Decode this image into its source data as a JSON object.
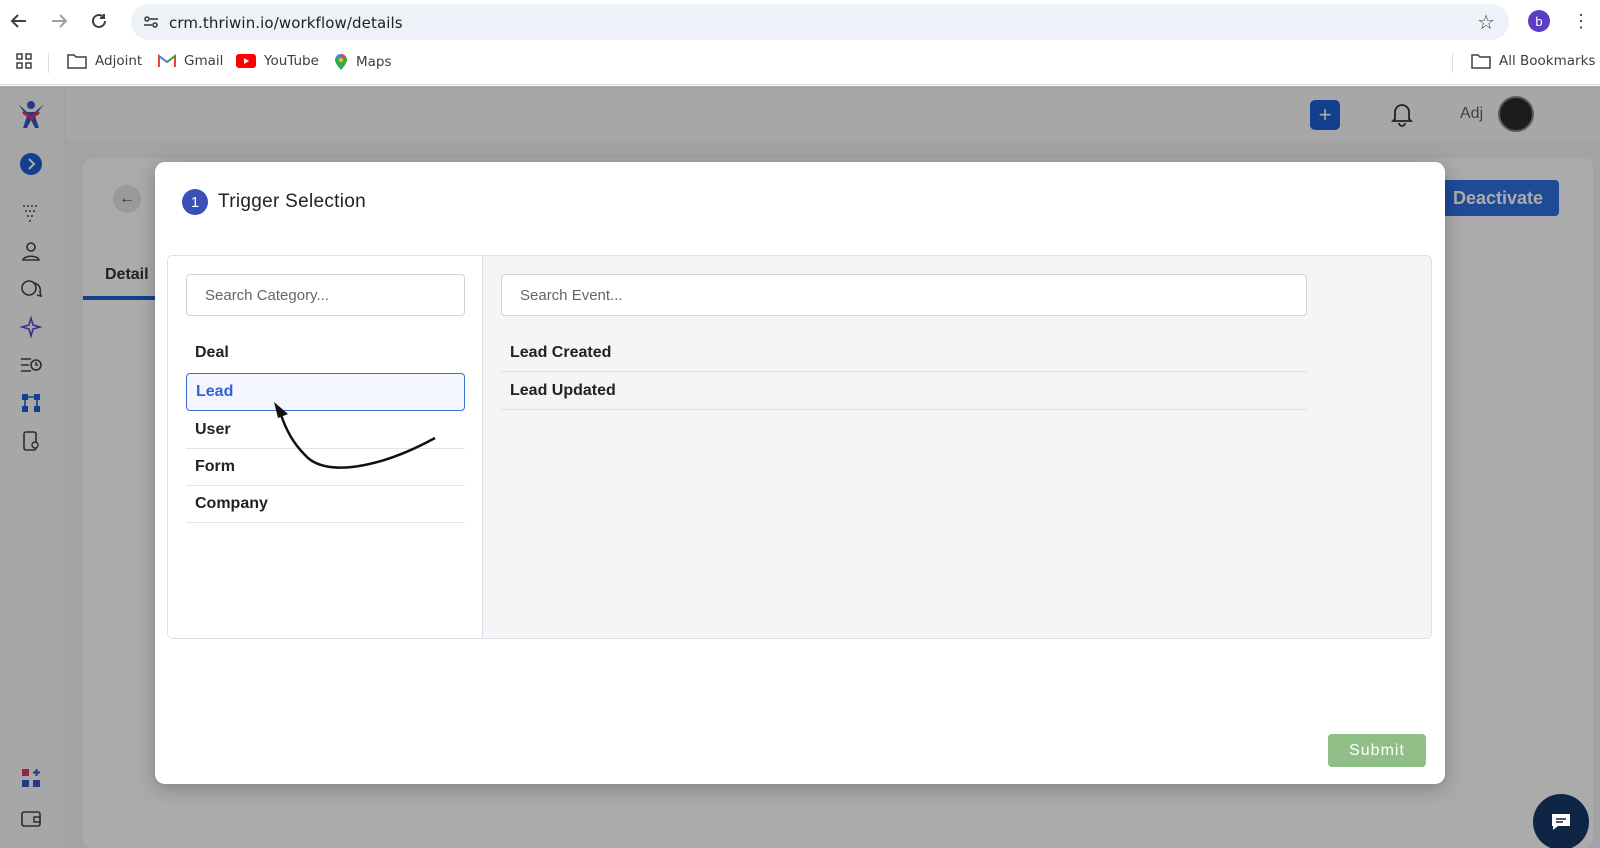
{
  "browser": {
    "url": "crm.thriwin.io/workflow/details",
    "profile_initial": "b",
    "bookmarks": [
      {
        "label": "Adjoint",
        "icon": "folder-icon"
      },
      {
        "label": "Gmail",
        "icon": "gmail-icon"
      },
      {
        "label": "YouTube",
        "icon": "youtube-icon"
      },
      {
        "label": "Maps",
        "icon": "maps-icon"
      }
    ],
    "all_bookmarks_label": "All Bookmarks"
  },
  "app": {
    "header_user": "Adj",
    "deactivate_label": "Deactivate",
    "detail_tab_label": "Detail",
    "accent_color": "#1f5fd6"
  },
  "modal": {
    "step_number": "1",
    "title": "Trigger Selection",
    "category_search_placeholder": "Search Category...",
    "event_search_placeholder": "Search Event...",
    "categories": [
      "Deal",
      "Lead",
      "User",
      "Form",
      "Company"
    ],
    "selected_category": "Lead",
    "events": [
      "Lead Created",
      "Lead Updated"
    ],
    "submit_label": "Submit",
    "submit_color": "#8fbf87"
  }
}
